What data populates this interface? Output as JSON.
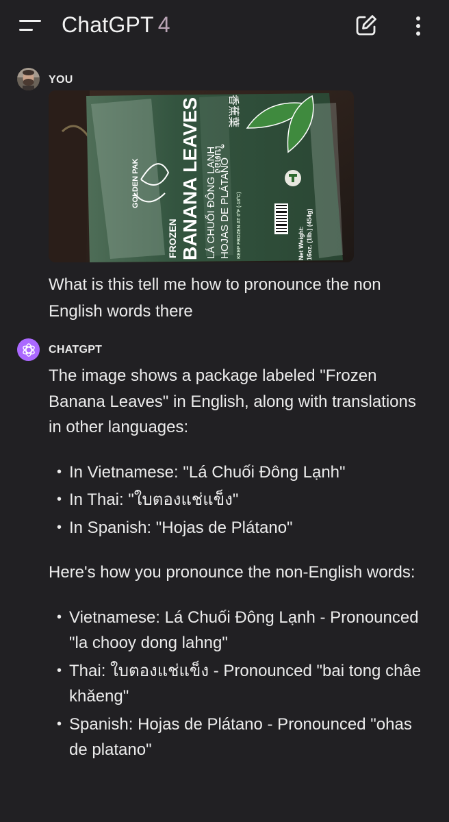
{
  "header": {
    "title": "ChatGPT",
    "version": "4",
    "menu_icon": "hamburger-menu-icon",
    "new_chat_icon": "edit-square-icon",
    "more_icon": "vertical-ellipsis-icon"
  },
  "user_message": {
    "author": "YOU",
    "image_text": {
      "brand": "GOLDEN PAK",
      "frozen": "FROZEN",
      "product": "BANANA LEAVES",
      "vietnamese": "LÁ CHUỐI ĐÔNG LẠNH",
      "spanish": "HOJAS DE PLÁTANO",
      "keep": "KEEP FROZEN AT 0°F (-18°C)",
      "net_weight": "Net Weight:",
      "weight": "16oz. (1lb.) (454g)",
      "thai": "ใบตอง",
      "chinese": "香蕉葉"
    },
    "text": "What is this tell me how to pronounce the non English words there"
  },
  "assistant_message": {
    "author": "CHATGPT",
    "intro": "The image shows a package labeled \"Frozen Banana Leaves\" in English, along with translations in other languages:",
    "translations": [
      "In Vietnamese: \"Lá Chuối Đông Lạnh\"",
      "In Thai: \"ใบตองแช่แข็ง\"",
      "In Spanish: \"Hojas de Plátano\""
    ],
    "pronounce_intro": "Here's how you pronounce the non-English words:",
    "pronunciations": [
      "Vietnamese: Lá Chuối Đông Lạnh - Pronounced \"la chooy dong lahng\"",
      "Thai: ใบตองแช่แข็ง - Pronounced \"bai tong châe khǎeng\"",
      "Spanish: Hojas de Plátano - Pronounced \"ohas de platano\""
    ]
  },
  "colors": {
    "background": "#212023",
    "text": "#ececec",
    "assistant_avatar": "#ab68ff",
    "version_accent": "#b9a4b5",
    "package_green": "#2f5a3c"
  }
}
